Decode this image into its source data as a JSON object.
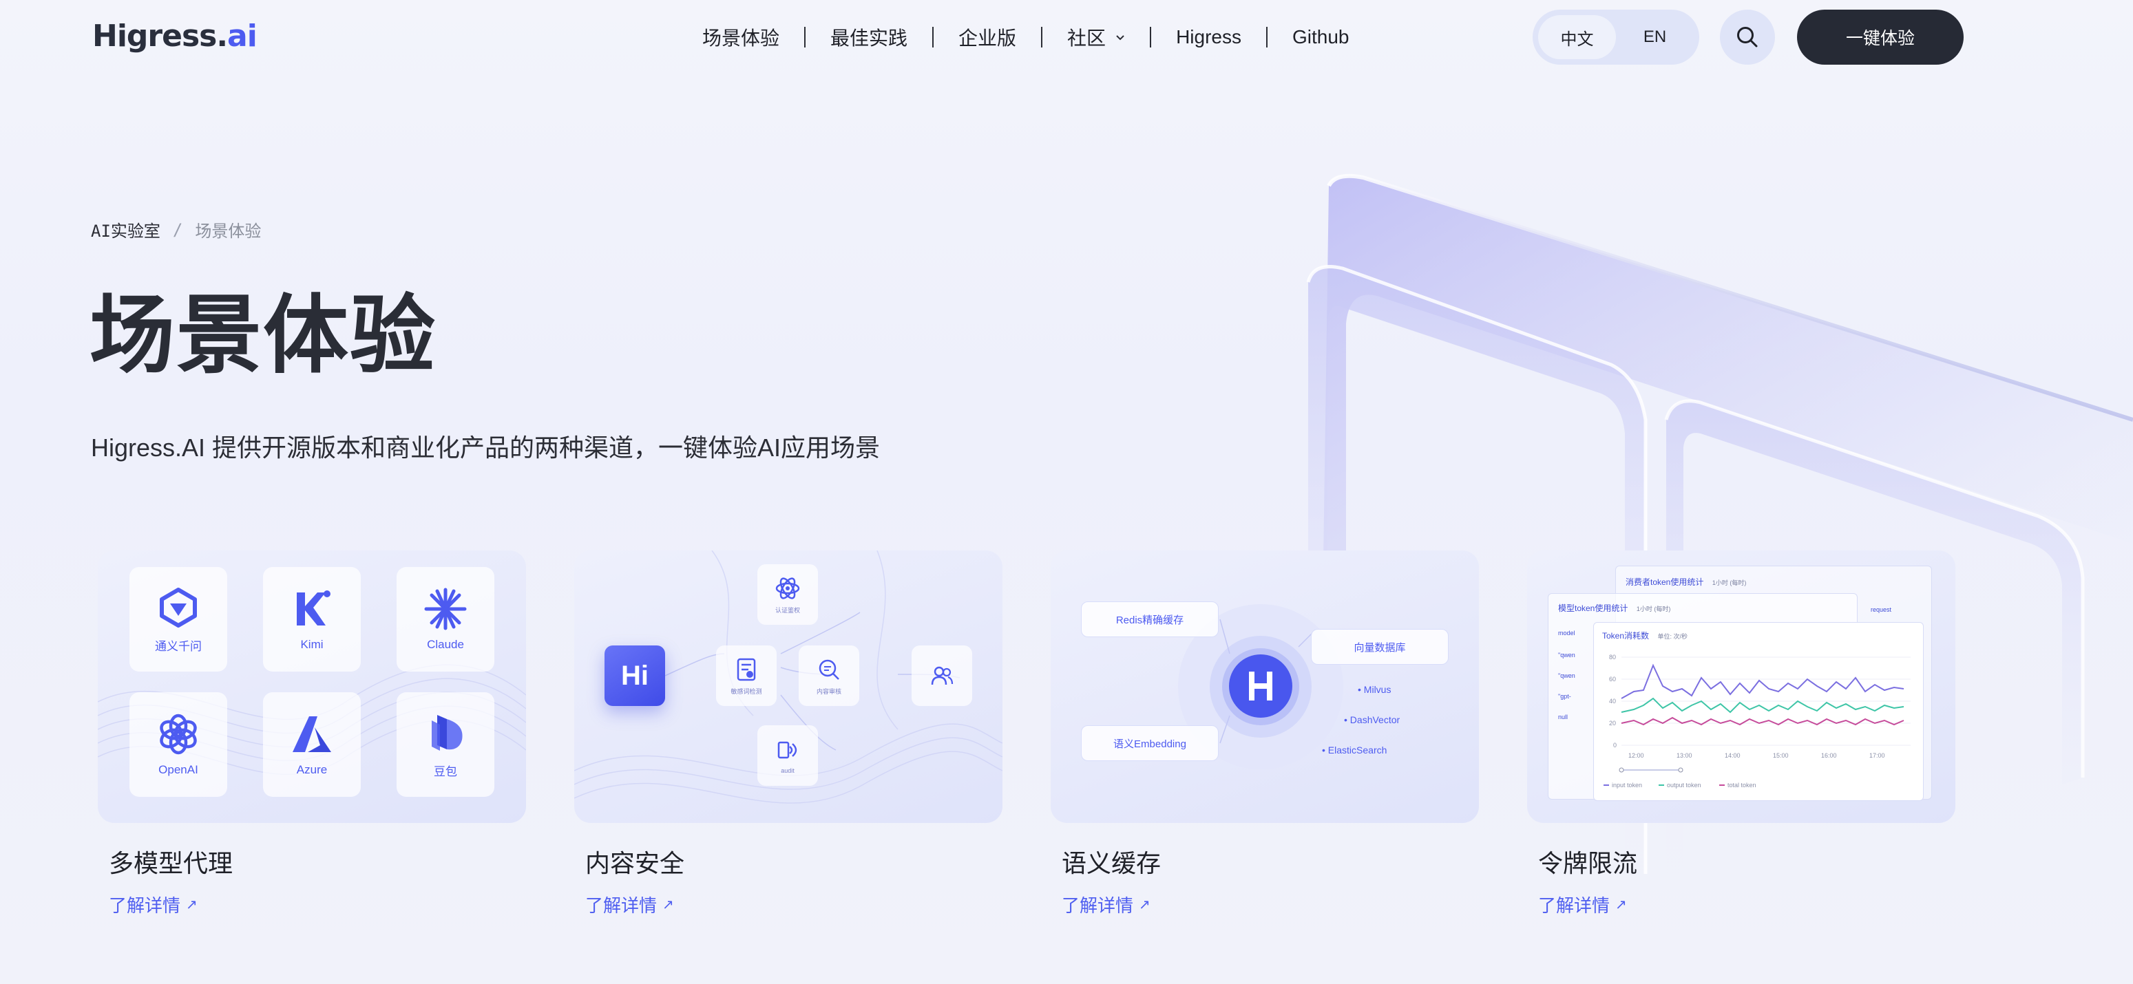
{
  "header": {
    "logo_main": "Higress.",
    "logo_ai": "ai",
    "nav": [
      {
        "label": "场景体验"
      },
      {
        "label": "最佳实践"
      },
      {
        "label": "企业版"
      },
      {
        "label": "社区"
      },
      {
        "label": "Higress"
      },
      {
        "label": "Github"
      }
    ],
    "lang": {
      "zh": "中文",
      "en": "EN",
      "active": "zh"
    },
    "cta_label": "一键体验"
  },
  "breadcrumb": {
    "root": "AI实验室",
    "separator": "/",
    "current": "场景体验"
  },
  "hero": {
    "title": "场景体验",
    "subtitle": "Higress.AI 提供开源版本和商业化产品的两种渠道，一键体验AI应用场景"
  },
  "cards": [
    {
      "title": "多模型代理",
      "link": "了解详情",
      "models": [
        "通义千问",
        "Kimi",
        "Claude",
        "OpenAI",
        "Azure",
        "豆包"
      ]
    },
    {
      "title": "内容安全",
      "link": "了解详情",
      "items": [
        "认证鉴权",
        "敏感词检测",
        "内容审核",
        "audit"
      ]
    },
    {
      "title": "语义缓存",
      "link": "了解详情",
      "redis": "Redis精确缓存",
      "embedding": "语义Embedding",
      "vector_db": "向量数据库",
      "vectors": [
        "Milvus",
        "DashVector",
        "ElasticSearch"
      ]
    },
    {
      "title": "令牌限流",
      "link": "了解详情",
      "dash_back_title": "消费者token使用统计",
      "dash_back_meta": "1小时 (每时)",
      "dash_mid_title": "模型token使用统计",
      "dash_mid_meta": "1小时 (每时)",
      "dash_front_title": "Token消耗数",
      "dash_front_meta": "单位: 次/秒",
      "request_label": "request",
      "model_col": "model",
      "model_rows": [
        "\"qwen",
        "\"qwen",
        "\"gpt-",
        "null"
      ],
      "y_ticks": [
        "80",
        "60",
        "40",
        "20",
        "0"
      ],
      "x_ticks": [
        "12:00",
        "13:00",
        "14:00",
        "15:00",
        "16:00",
        "17:00"
      ],
      "legend": [
        "input token",
        "output token",
        "total token"
      ],
      "colors": {
        "input": "#7b6fe0",
        "output": "#3ec5a7",
        "total": "#c64b9a"
      }
    }
  ]
}
